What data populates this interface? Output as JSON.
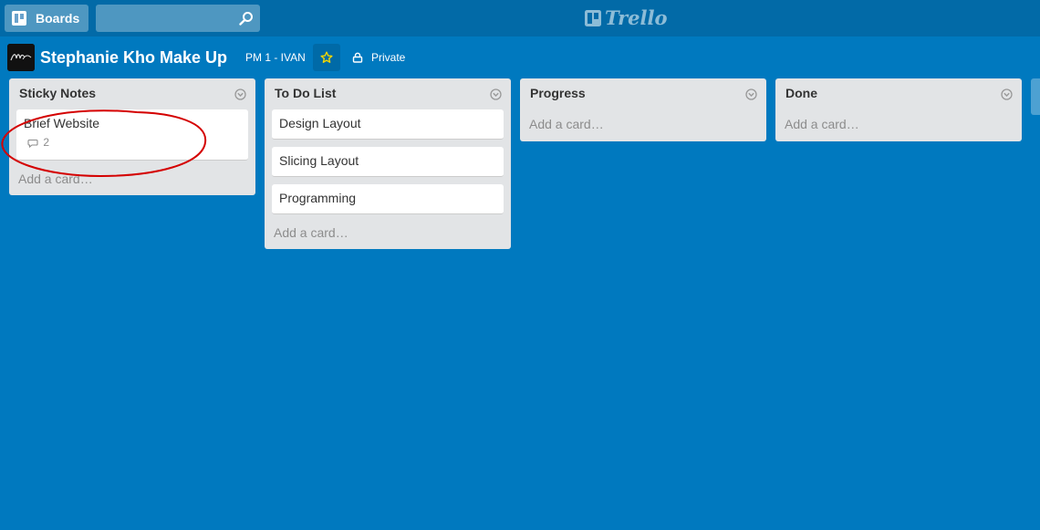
{
  "header": {
    "boards_label": "Boards",
    "search_value": "",
    "logo_text": "Trello"
  },
  "board": {
    "title": "Stephanie Kho Make Up",
    "team": "PM 1 - IVAN",
    "privacy": "Private",
    "starred": true
  },
  "lists": [
    {
      "name": "Sticky Notes",
      "cards": [
        {
          "title": "Brief Website",
          "comments": "2"
        }
      ],
      "add_label": "Add a card…"
    },
    {
      "name": "To Do List",
      "cards": [
        {
          "title": "Design Layout"
        },
        {
          "title": "Slicing Layout"
        },
        {
          "title": "Programming"
        }
      ],
      "add_label": "Add a card…"
    },
    {
      "name": "Progress",
      "cards": [],
      "add_label": "Add a card…"
    },
    {
      "name": "Done",
      "cards": [],
      "add_label": "Add a card…"
    }
  ],
  "colors": {
    "board_bg": "#0079bf",
    "header_bg": "#026aa7",
    "list_bg": "#e2e4e6",
    "annotation": "#d40000",
    "star": "#f2d600"
  },
  "icons": [
    "boards-icon",
    "search-icon",
    "trello-logo-icon",
    "star-icon",
    "lock-icon",
    "list-menu-icon",
    "comment-icon"
  ]
}
